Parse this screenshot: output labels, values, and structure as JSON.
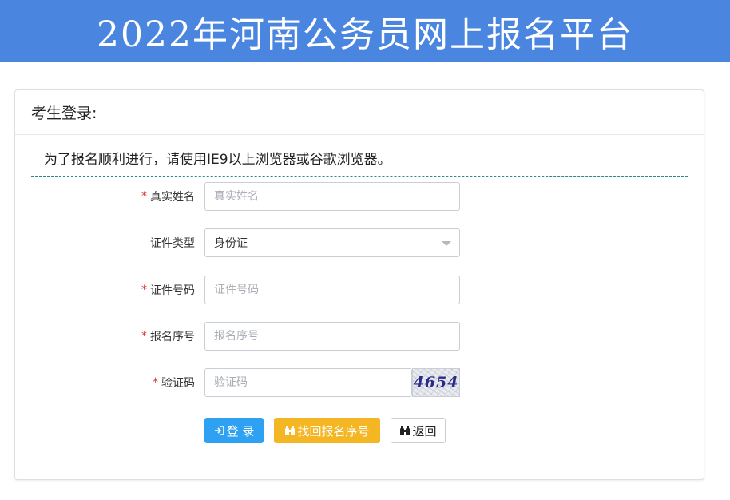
{
  "banner": {
    "title": "2022年河南公务员网上报名平台"
  },
  "panel": {
    "title": "考生登录:"
  },
  "notice": {
    "text": "为了报名顺利进行，请使用IE9以上浏览器或谷歌浏览器。"
  },
  "form": {
    "required_mark": "*",
    "name": {
      "label": "真实姓名",
      "placeholder": "真实姓名",
      "value": ""
    },
    "id_type": {
      "label": "证件类型",
      "selected": "身份证"
    },
    "id_number": {
      "label": "证件号码",
      "placeholder": "证件号码",
      "value": ""
    },
    "reg_number": {
      "label": "报名序号",
      "placeholder": "报名序号",
      "value": ""
    },
    "captcha": {
      "label": "验证码",
      "placeholder": "验证码",
      "value": "",
      "image_text": "4654"
    }
  },
  "buttons": {
    "login": {
      "icon": "login-icon",
      "label": "登 录"
    },
    "find": {
      "icon": "binoculars-icon",
      "label": "找回报名序号"
    },
    "back": {
      "icon": "binoculars-icon",
      "label": "返回"
    }
  },
  "colors": {
    "banner": "#4a86e0",
    "login_button": "#2ea1f3",
    "find_button": "#f5b623",
    "required_mark": "#e03030",
    "notice_divider": "#2a8a8a"
  }
}
